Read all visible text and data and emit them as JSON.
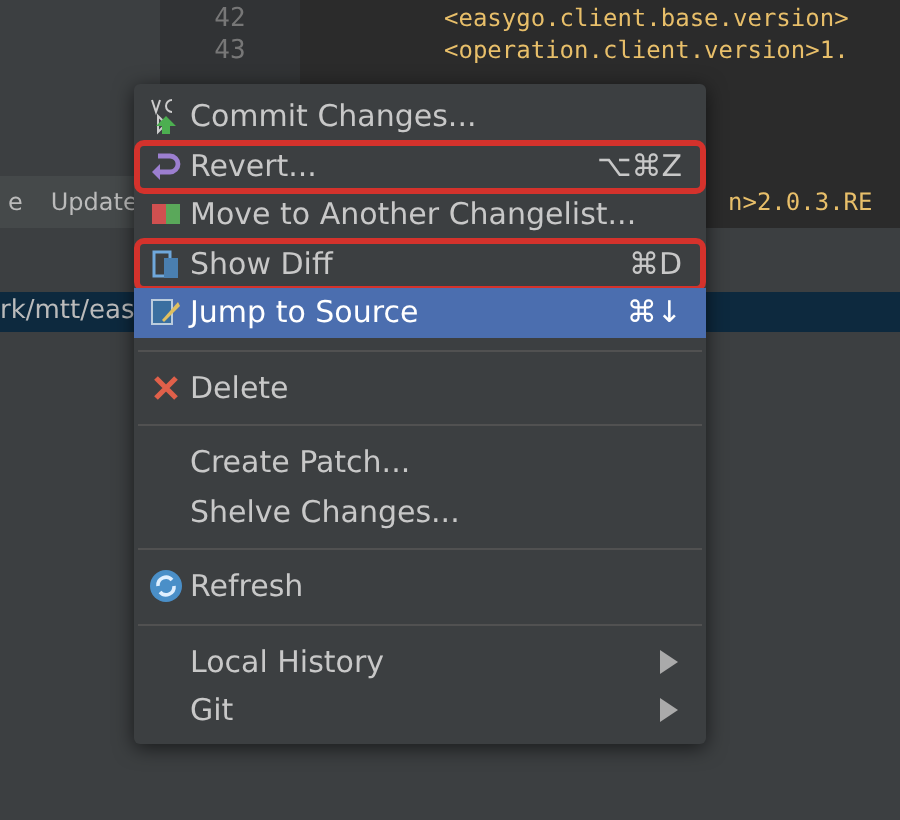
{
  "editor": {
    "lines": [
      {
        "number": "42",
        "code": "<easygo.client.base.version>"
      },
      {
        "number": "43",
        "code": "<operation.client.version>1."
      }
    ],
    "code_right": "n>2.0.3.RE"
  },
  "toolbar": {
    "label": "e",
    "button": "Update"
  },
  "path_row": {
    "text": "rk/mtt/eas",
    "selected": true
  },
  "menu": {
    "items": [
      {
        "kind": "item",
        "label": "Commit Changes...",
        "selected": false,
        "annotated": false
      },
      {
        "kind": "item",
        "label": "Revert...",
        "shortcut": "⌥⌘Z",
        "selected": false,
        "annotated": true
      },
      {
        "kind": "item",
        "label": "Move to Another Changelist...",
        "selected": false,
        "annotated": false
      },
      {
        "kind": "item",
        "label": "Show Diff",
        "shortcut": "⌘D",
        "selected": false,
        "annotated": true
      },
      {
        "kind": "item",
        "label": "Jump to Source",
        "shortcut": "⌘↓",
        "selected": true,
        "annotated": false
      },
      {
        "kind": "separator"
      },
      {
        "kind": "item",
        "label": "Delete",
        "selected": false,
        "annotated": false
      },
      {
        "kind": "separator"
      },
      {
        "kind": "item",
        "label": "Create Patch...",
        "selected": false,
        "annotated": false
      },
      {
        "kind": "item",
        "label": "Shelve Changes...",
        "selected": false,
        "annotated": false
      },
      {
        "kind": "separator"
      },
      {
        "kind": "item",
        "label": "Refresh",
        "selected": false,
        "annotated": false
      },
      {
        "kind": "separator"
      },
      {
        "kind": "item",
        "label": "Local History",
        "submenu": true,
        "selected": false,
        "annotated": false
      },
      {
        "kind": "item",
        "label": "Git",
        "submenu": true,
        "selected": false,
        "annotated": false
      }
    ]
  }
}
